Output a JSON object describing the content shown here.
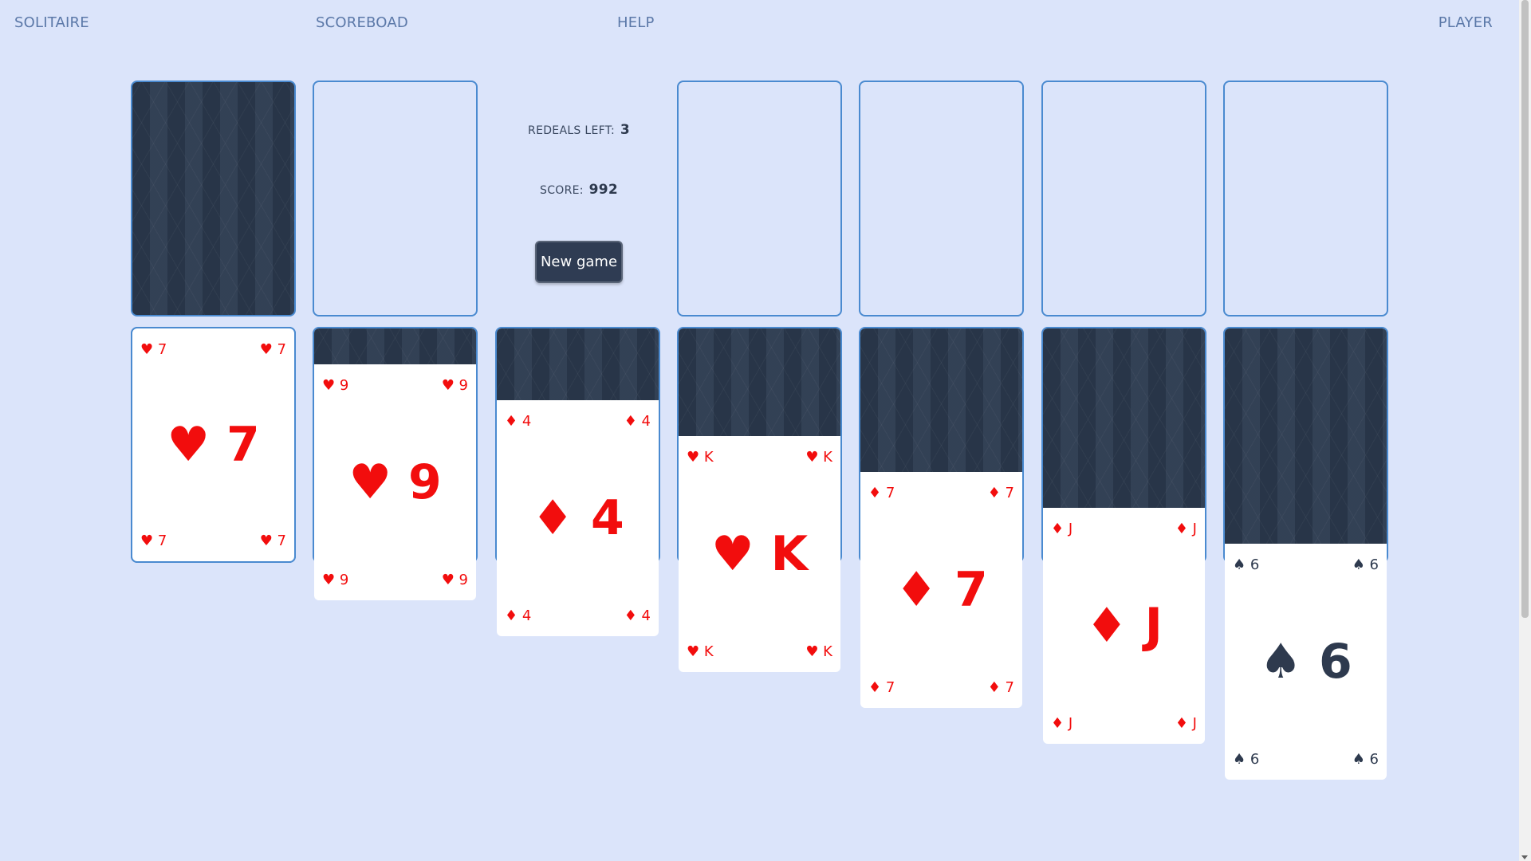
{
  "nav": {
    "solitaire": "SOLITAIRE",
    "scoreboard": "SCOREBOAD",
    "help": "HELP",
    "player": "PLAYER"
  },
  "status": {
    "redeals_label": "REDEALS LEFT:",
    "redeals_value": "3",
    "score_label": "SCORE:",
    "score_value": "992",
    "new_game_label": "New game"
  },
  "tableau": [
    {
      "hidden": 0,
      "rank": "7",
      "suit": "♥",
      "color": "red"
    },
    {
      "hidden": 1,
      "rank": "9",
      "suit": "♥",
      "color": "red"
    },
    {
      "hidden": 2,
      "rank": "4",
      "suit": "♦",
      "color": "red"
    },
    {
      "hidden": 3,
      "rank": "K",
      "suit": "♥",
      "color": "red"
    },
    {
      "hidden": 4,
      "rank": "7",
      "suit": "♦",
      "color": "red"
    },
    {
      "hidden": 5,
      "rank": "J",
      "suit": "♦",
      "color": "red"
    },
    {
      "hidden": 6,
      "rank": "6",
      "suit": "♠",
      "color": "black"
    }
  ],
  "colors": {
    "background": "#dbe4fa",
    "slot_border": "#4a8ad0",
    "red_suit": "#f20d0d",
    "black_suit": "#2e3a4e",
    "card_back": "#2c3b50"
  }
}
